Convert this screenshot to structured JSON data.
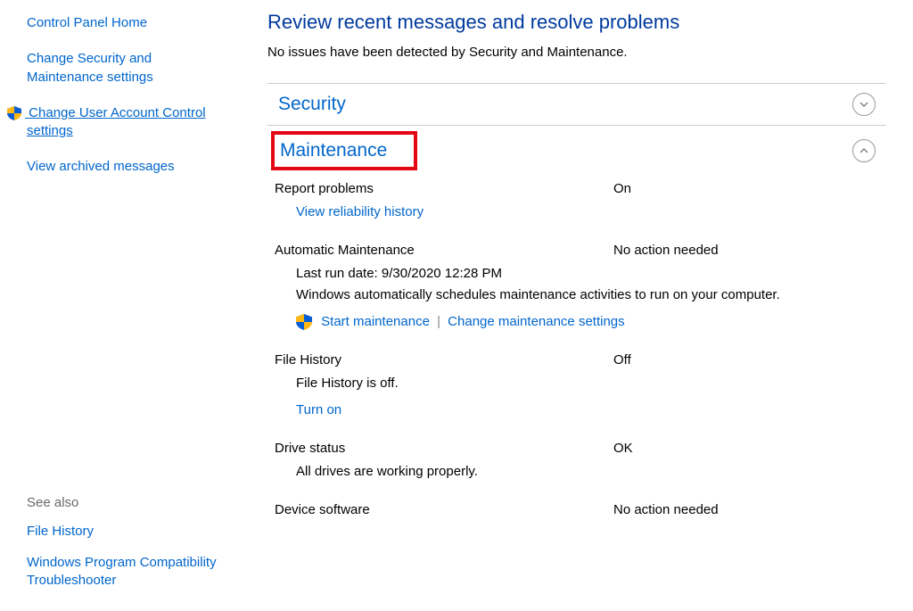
{
  "sidebar": {
    "items": [
      {
        "label": "Control Panel Home"
      },
      {
        "label": "Change Security and Maintenance settings"
      },
      {
        "label": "Change User Account Control settings"
      },
      {
        "label": "View archived messages"
      }
    ],
    "see_also_head": "See also",
    "see_also": [
      {
        "label": "File History"
      },
      {
        "label": "Windows Program Compatibility Troubleshooter"
      }
    ]
  },
  "main": {
    "title": "Review recent messages and resolve problems",
    "status": "No issues have been detected by Security and Maintenance.",
    "security_title": "Security",
    "maintenance_title": "Maintenance",
    "report_problems": {
      "label": "Report problems",
      "value": "On",
      "link": "View reliability history"
    },
    "auto_maint": {
      "label": "Automatic Maintenance",
      "value": "No action needed",
      "last_run": "Last run date: 9/30/2020 12:28 PM",
      "desc": "Windows automatically schedules maintenance activities to run on your computer.",
      "start": "Start maintenance",
      "change": "Change maintenance settings"
    },
    "file_history": {
      "label": "File History",
      "value": "Off",
      "desc": "File History is off.",
      "action": "Turn on"
    },
    "drive_status": {
      "label": "Drive status",
      "value": "OK",
      "desc": "All drives are working properly."
    },
    "device_software": {
      "label": "Device software",
      "value": "No action needed"
    }
  }
}
